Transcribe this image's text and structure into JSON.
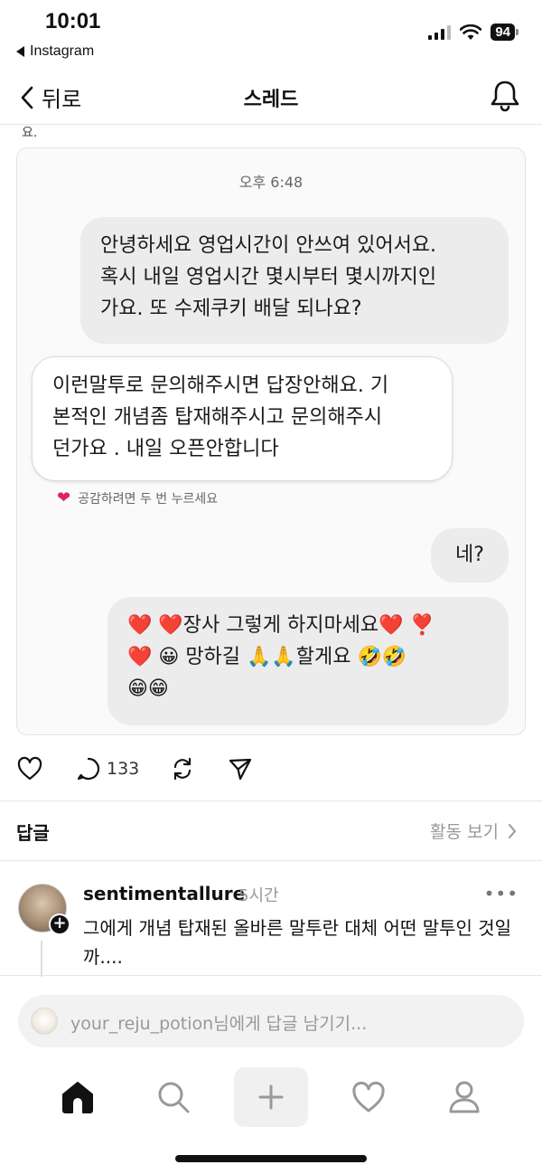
{
  "status_bar": {
    "time": "10:01",
    "back_app": "Instagram",
    "battery": "94",
    "icons": [
      "signal-icon",
      "wifi-icon",
      "battery-icon"
    ]
  },
  "header": {
    "back_label": "뒤로",
    "title": "스레드",
    "icons": [
      "chevron-left-icon",
      "bell-icon"
    ]
  },
  "post": {
    "cut_text": "요.",
    "screenshot": {
      "time": "오후 6:48",
      "messages": [
        {
          "from": "sent",
          "lines": [
            "안녕하세요 영업시간이 안쓰여 있어서요.",
            "혹시 내일 영업시간 몇시부터 몇시까지인",
            "가요. 또 수제쿠키 배달 되나요?"
          ]
        },
        {
          "from": "received",
          "lines": [
            "이런말투로 문의해주시면 답장안해요. 기",
            "본적인 개념좀 탑재해주시고 문의해주시",
            "던가요 . 내일 오픈안합니다"
          ]
        },
        {
          "from": "sent",
          "lines": [
            "네?"
          ]
        },
        {
          "from": "sent",
          "lines": [
            "❤️ ❤️장사 그렇게 하지마세요❤️ ❣️",
            "❤️ 😀 망하길 🙏🙏할게요 🤣🤣",
            "😁😁"
          ]
        }
      ],
      "reaction_hint": "공감하려면 두 번 누르세요"
    },
    "actions": {
      "comment_count": "133",
      "icons": [
        "heart-icon",
        "comment-icon",
        "repost-icon",
        "share-icon"
      ]
    }
  },
  "replies": {
    "title": "답글",
    "activity_link": "활동 보기",
    "comment": {
      "username": "sentimentallure",
      "time": "5시간",
      "text": "그에게 개념 탑재된 올바른 말투란 대체 어떤 말투인 것일까....",
      "more": "•••"
    }
  },
  "reply_input": {
    "placeholder": "your_reju_potion님에게 답글 남기기..."
  },
  "tab_bar": {
    "tabs": [
      "home-icon",
      "search-icon",
      "plus-icon",
      "heart-icon",
      "profile-icon"
    ]
  },
  "colors": {
    "accent_heart": "#e0245e",
    "sent_bubble": "#ececec",
    "received_bubble": "#ffffff",
    "muted_text": "#999999"
  }
}
